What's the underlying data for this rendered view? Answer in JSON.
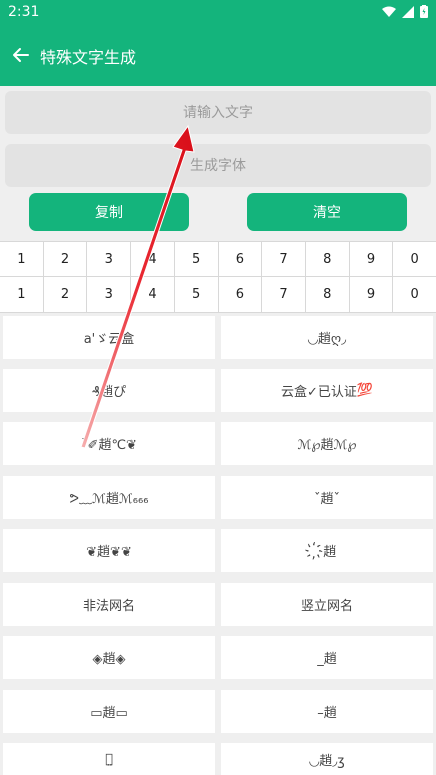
{
  "status": {
    "time": "2:31"
  },
  "appbar": {
    "title": "特殊文字生成"
  },
  "input": {
    "placeholder": "请输入文字"
  },
  "output": {
    "placeholder": "生成字体"
  },
  "buttons": {
    "copy": "复制",
    "clear": "清空"
  },
  "number_rows": [
    [
      "1",
      "2",
      "3",
      "4",
      "5",
      "6",
      "7",
      "8",
      "9",
      "0"
    ],
    [
      "1",
      "2",
      "3",
      "4",
      "5",
      "6",
      "7",
      "8",
      "9",
      "0"
    ]
  ],
  "styles": [
    "a'ゞ云盒",
    "◟◞趙ღ◞",
    "₰趙ぴ",
    "云盒✓已认证",
    "ˋ✐趙℃❦",
    "ℳ℘趙ℳ℘",
    "ᕗ﹏ℳ趙ℳ₆₆₆",
    "ˇ趙ˇ",
    "❦趙❦❦",
    "҉趙",
    "非法网名",
    "竖立网名",
    "◈趙◈",
    "_趙",
    "▭趙▭",
    "–趙",
    "趙̤",
    "◟◞趙◞ʒ"
  ],
  "badge_text": "💯",
  "colors": {
    "primary": "#14b47c",
    "arrow": "#e8101e"
  }
}
